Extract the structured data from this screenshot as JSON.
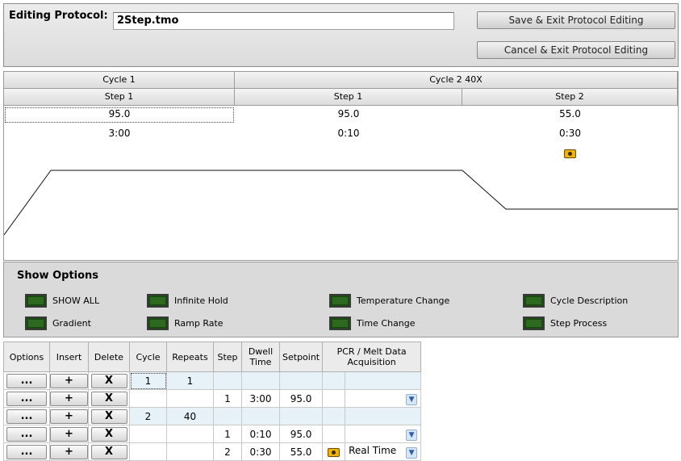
{
  "header": {
    "protocol_label": "Editing Protocol:",
    "protocol_name": "2Step.tmo",
    "save_button": "Save & Exit Protocol Editing",
    "cancel_button": "Cancel & Exit Protocol Editing"
  },
  "protocol": {
    "cycles": [
      {
        "label": "Cycle 1",
        "steps": [
          {
            "label": "Step 1",
            "setpoint": "95.0",
            "time": "3:00",
            "acquire": false
          }
        ]
      },
      {
        "label": "Cycle 2 40X",
        "steps": [
          {
            "label": "Step 1",
            "setpoint": "95.0",
            "time": "0:10",
            "acquire": false
          },
          {
            "label": "Step 2",
            "setpoint": "55.0",
            "time": "0:30",
            "acquire": true
          }
        ]
      }
    ]
  },
  "show_options": {
    "title": "Show Options",
    "items": [
      "SHOW ALL",
      "Infinite Hold",
      "Temperature Change",
      "Cycle Description",
      "Gradient",
      "Ramp Rate",
      "Time Change",
      "Step Process"
    ]
  },
  "table": {
    "headers": [
      "Options",
      "Insert",
      "Delete",
      "Cycle",
      "Repeats",
      "Step",
      "Dwell Time",
      "Setpoint",
      "PCR / Melt Data Acquisition"
    ],
    "button_labels": {
      "options": "...",
      "insert": "+",
      "delete": "X"
    },
    "dropdown_icon": "chevron-down-icon",
    "rows": [
      {
        "type": "cycle",
        "cycle": "1",
        "repeats": "1",
        "step": "",
        "dwell": "",
        "setpoint": "",
        "acquisition": ""
      },
      {
        "type": "step",
        "cycle": "",
        "repeats": "",
        "step": "1",
        "dwell": "3:00",
        "setpoint": "95.0",
        "acquisition": ""
      },
      {
        "type": "cycle",
        "cycle": "2",
        "repeats": "40",
        "step": "",
        "dwell": "",
        "setpoint": "",
        "acquisition": ""
      },
      {
        "type": "step",
        "cycle": "",
        "repeats": "",
        "step": "1",
        "dwell": "0:10",
        "setpoint": "95.0",
        "acquisition": ""
      },
      {
        "type": "step",
        "cycle": "",
        "repeats": "",
        "step": "2",
        "dwell": "0:30",
        "setpoint": "55.0",
        "acquisition": "Real Time"
      }
    ]
  },
  "colors": {
    "led_green": "#2d6a1f",
    "cycle_row": "#e6f1f8",
    "camera": "#f1b300"
  }
}
